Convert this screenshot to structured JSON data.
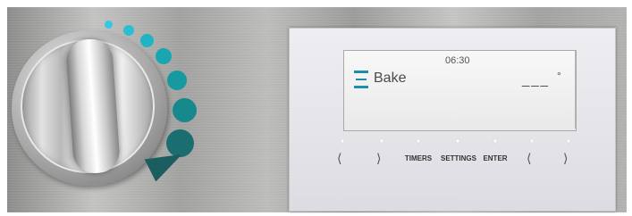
{
  "display": {
    "time": "06:30",
    "mode_label": "Bake",
    "temperature": "___",
    "temperature_unit": "°"
  },
  "keys": {
    "left_prev": "⟨",
    "left_next": "⟩",
    "timers": "TIMERS",
    "settings": "SETTINGS",
    "enter": "ENTER",
    "right_prev": "⟨",
    "right_next": "⟩"
  },
  "colors": {
    "teal_light": "#3ec4dd",
    "teal_mid": "#18a6b2",
    "teal_dark": "#1e6b6c",
    "icon_blue": "#1f8ea8"
  }
}
